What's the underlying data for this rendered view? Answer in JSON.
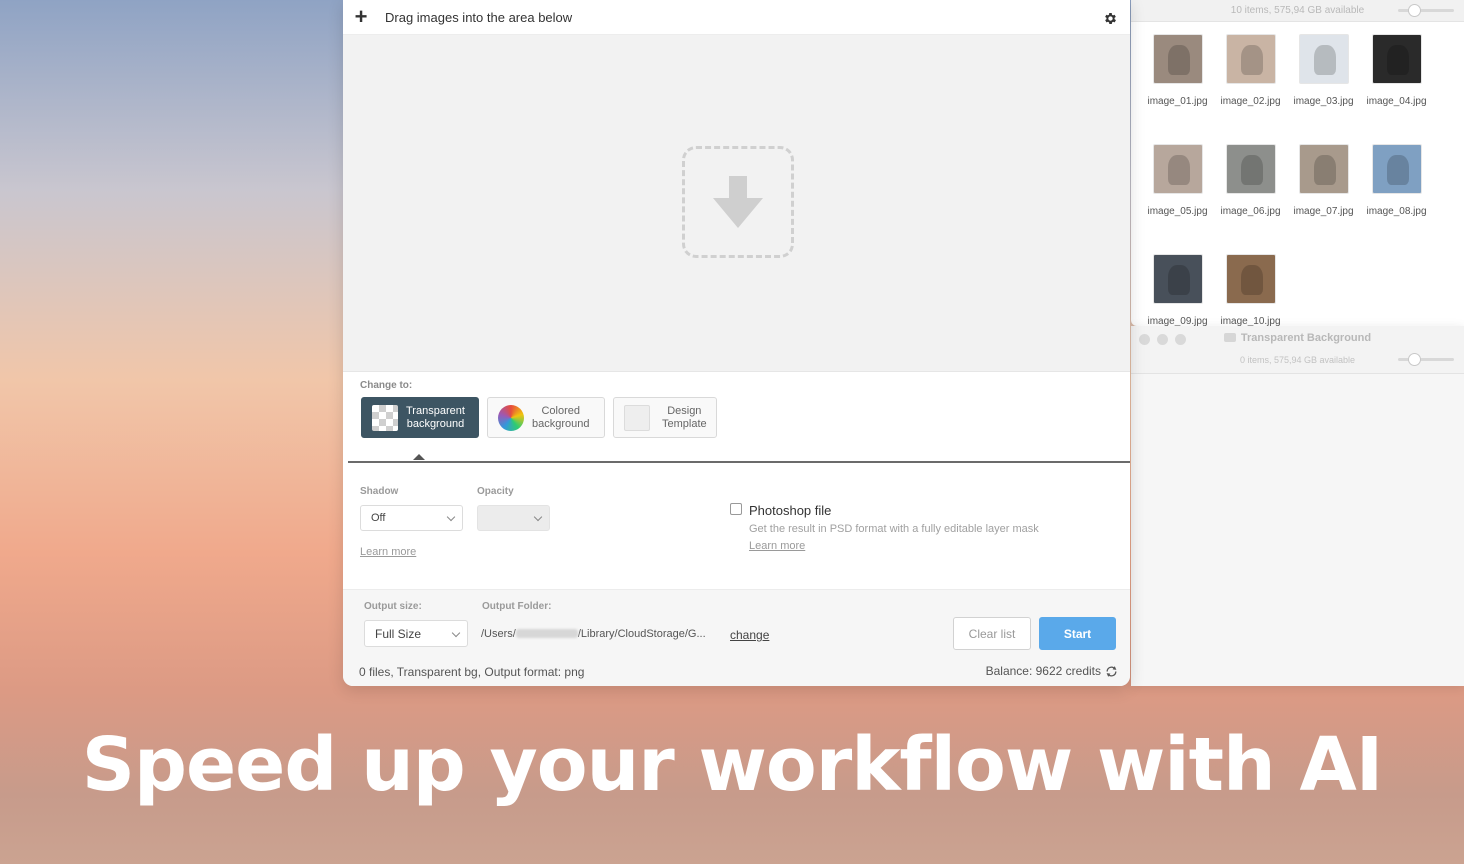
{
  "finder": {
    "status": "10 items, 575,94 GB available",
    "images": [
      {
        "label": "image_01.jpg",
        "color": "#9a8a7e"
      },
      {
        "label": "image_02.jpg",
        "color": "#c9b4a4"
      },
      {
        "label": "image_03.jpg",
        "color": "#dfe4ea"
      },
      {
        "label": "image_04.jpg",
        "color": "#2a2a2a"
      },
      {
        "label": "image_05.jpg",
        "color": "#b7a79c"
      },
      {
        "label": "image_06.jpg",
        "color": "#8d8f8c"
      },
      {
        "label": "image_07.jpg",
        "color": "#a89a8c"
      },
      {
        "label": "image_08.jpg",
        "color": "#7fa0c2"
      },
      {
        "label": "image_09.jpg",
        "color": "#48505a"
      },
      {
        "label": "image_10.jpg",
        "color": "#8a6a4e"
      }
    ]
  },
  "finder2": {
    "title": "Transparent Background",
    "status": "0 items, 575,94 GB available"
  },
  "header": {
    "drag_text": "Drag images into the area below"
  },
  "change_panel": {
    "label": "Change to:",
    "modes": [
      {
        "line1": "Transparent",
        "line2": "background",
        "active": true
      },
      {
        "line1": "Colored",
        "line2": "background",
        "active": false
      },
      {
        "line1": "Design",
        "line2": "Template",
        "active": false
      }
    ]
  },
  "options": {
    "shadow_label": "Shadow",
    "shadow_value": "Off",
    "opacity_label": "Opacity",
    "learn_more": "Learn more",
    "psd_title": "Photoshop file",
    "psd_desc": "Get the result in PSD format with a fully editable layer mask",
    "psd_learn_more": "Learn more"
  },
  "output": {
    "size_label": "Output size:",
    "size_value": "Full Size",
    "folder_label": "Output Folder:",
    "path_prefix": "/Users/",
    "path_suffix": "/Library/CloudStorage/G...",
    "change_link": "change",
    "clear_button": "Clear list",
    "start_button": "Start",
    "status_left": "0 files, Transparent bg, Output format: png",
    "balance": "Balance: 9622 credits"
  },
  "caption": "Speed up your workflow with AI",
  "colors": {
    "active_mode": "#3d5563",
    "start_button": "#5aa9ea"
  }
}
